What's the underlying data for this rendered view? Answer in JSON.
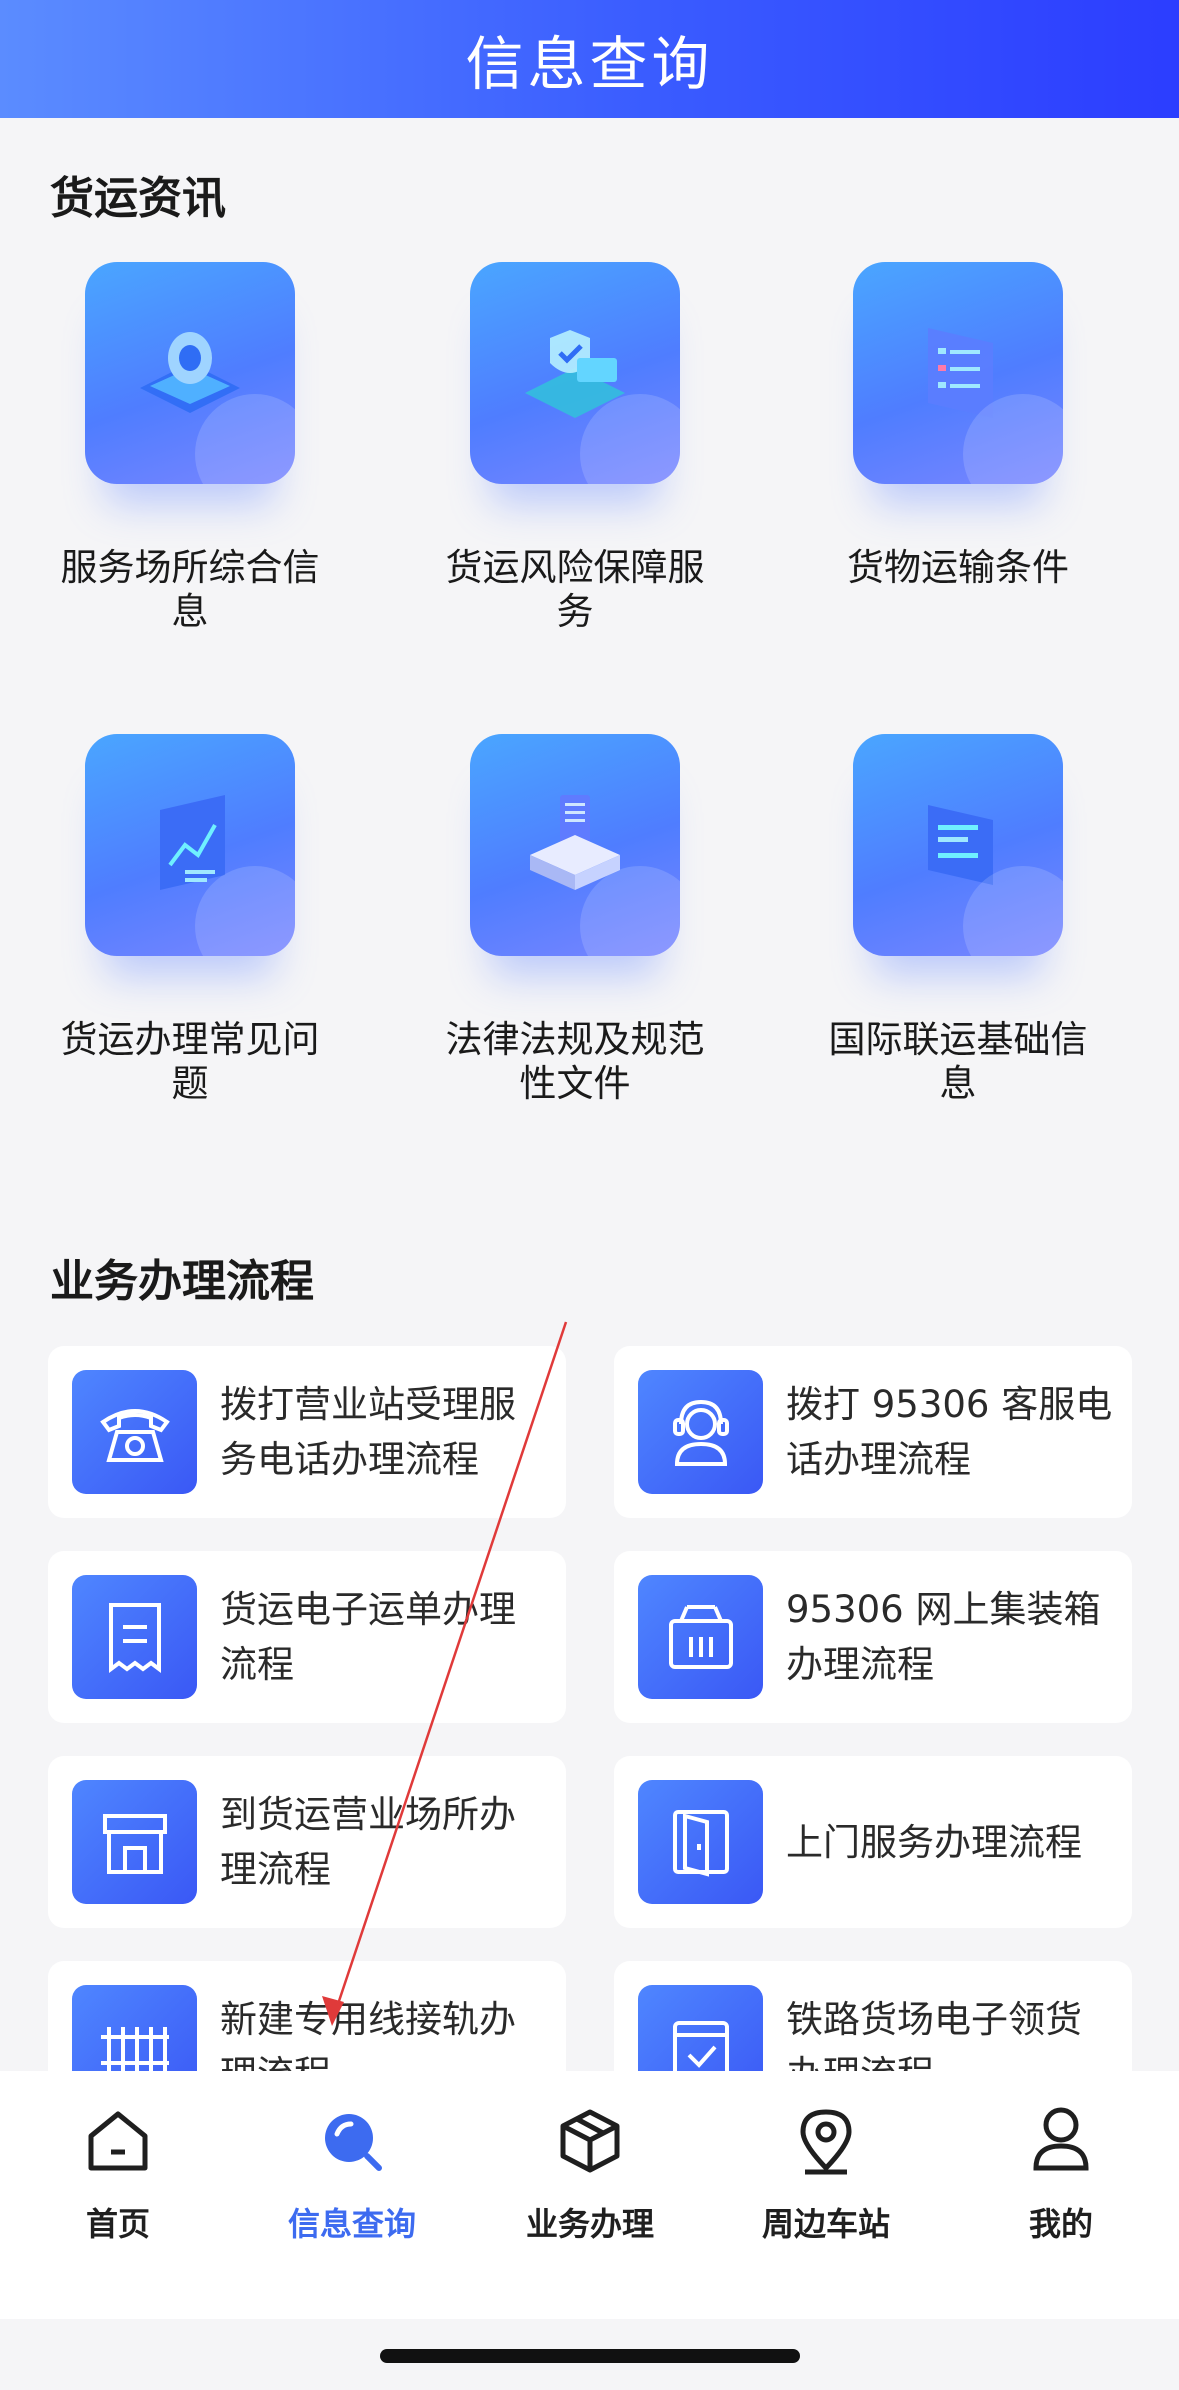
{
  "header": {
    "title": "信息查询"
  },
  "sections": {
    "freight_news": "货运资讯",
    "business_process": "业务办理流程"
  },
  "tiles": [
    {
      "label": "服务场所综合信息",
      "icon": "location-pin-icon"
    },
    {
      "label": "货运风险保障服务",
      "icon": "shield-icon"
    },
    {
      "label": "货物运输条件",
      "icon": "list-document-icon"
    },
    {
      "label": "货运办理常见问题",
      "icon": "question-chart-icon"
    },
    {
      "label": "法律法规及规范性文件",
      "icon": "document-stack-icon"
    },
    {
      "label": "国际联运基础信息",
      "icon": "info-panel-icon"
    }
  ],
  "cards": [
    {
      "label": "拨打营业站受理服务电话办理流程",
      "icon": "telephone-icon"
    },
    {
      "label": "拨打 95306 客服电话办理流程",
      "icon": "headset-agent-icon"
    },
    {
      "label": "货运电子运单办理流程",
      "icon": "receipt-icon"
    },
    {
      "label": "95306 网上集装箱办理流程",
      "icon": "container-icon"
    },
    {
      "label": "到货运营业场所办理流程",
      "icon": "storefront-icon"
    },
    {
      "label": "上门服务办理流程",
      "icon": "door-icon"
    },
    {
      "label": "新建专用线接轨办理流程",
      "icon": "rail-track-icon"
    },
    {
      "label": "铁路货场电子领货办理流程",
      "icon": "checkbox-icon"
    }
  ],
  "tabbar": {
    "items": [
      {
        "label": "首页",
        "icon": "home-icon",
        "active": false
      },
      {
        "label": "信息查询",
        "icon": "search-icon",
        "active": true
      },
      {
        "label": "业务办理",
        "icon": "box-icon",
        "active": false
      },
      {
        "label": "周边车站",
        "icon": "location-icon",
        "active": false
      },
      {
        "label": "我的",
        "icon": "user-icon",
        "active": false
      }
    ]
  },
  "colors": {
    "accent": "#3d6bf0",
    "header_start": "#5b8cff",
    "header_end": "#2c3dff"
  }
}
